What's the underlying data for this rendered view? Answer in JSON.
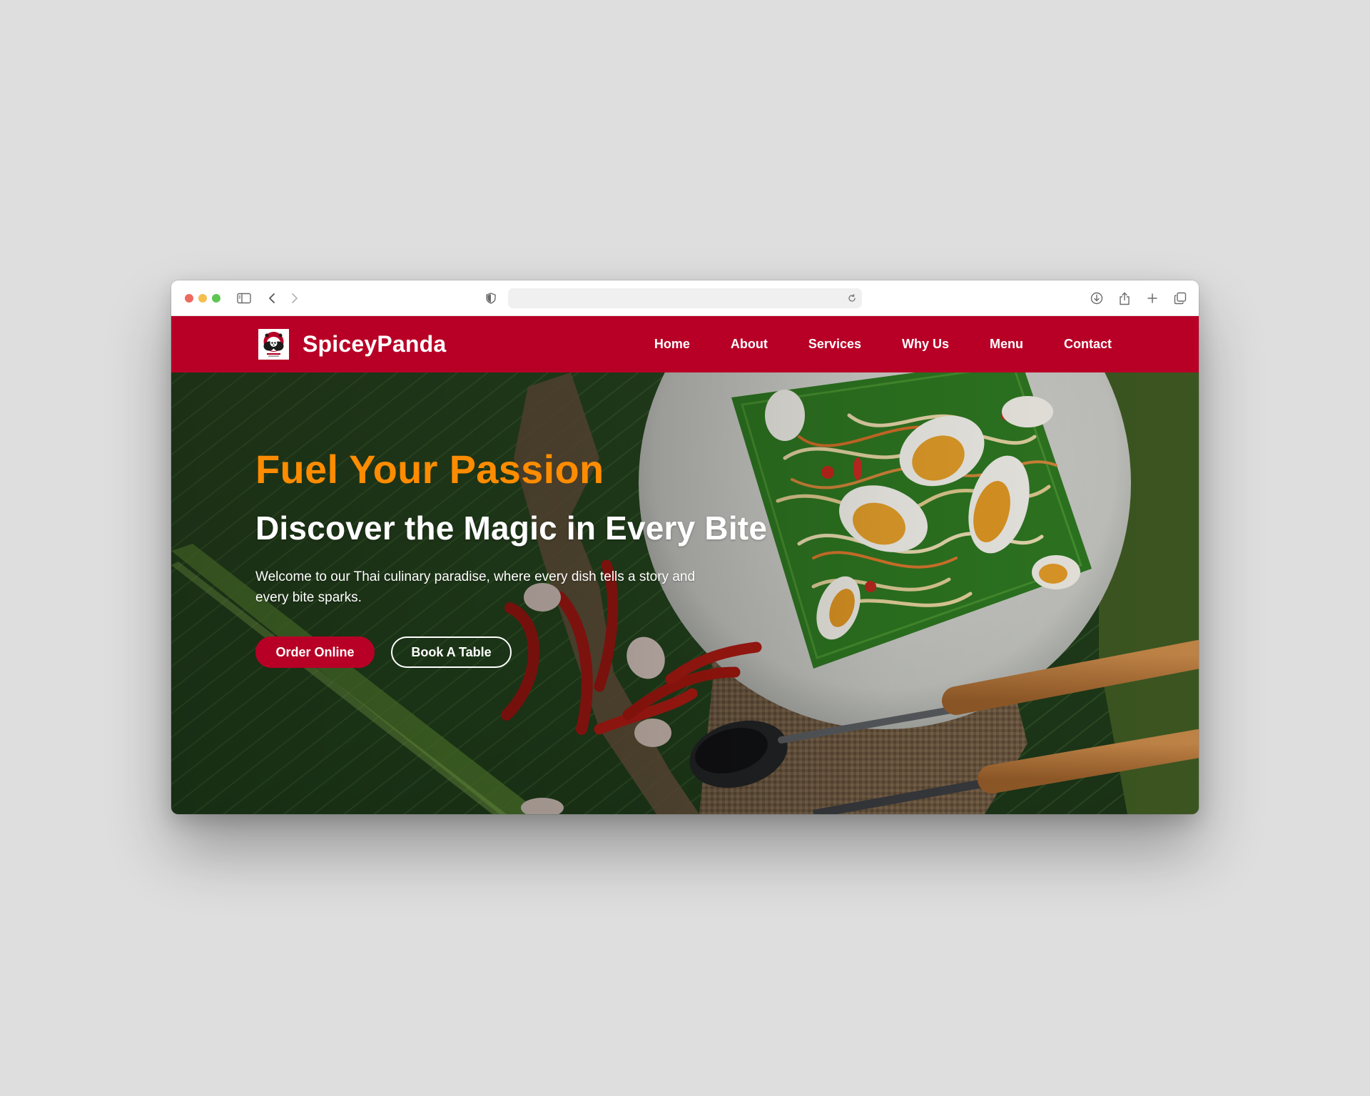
{
  "browser": {
    "address": "",
    "colors": {
      "close": "#ec6a5e",
      "minimize": "#f4bf4f",
      "zoom": "#61c554"
    }
  },
  "site": {
    "brand": "SpiceyPanda",
    "nav": [
      "Home",
      "About",
      "Services",
      "Why Us",
      "Menu",
      "Contact"
    ],
    "colors": {
      "header": "#b80026",
      "accent": "#ff8c00",
      "text": "#ffffff"
    }
  },
  "hero": {
    "tagline": "Fuel Your Passion",
    "title": "Discover the Magic in Every Bite",
    "description": "Welcome to our Thai culinary paradise, where every dish tells a story and every bite sparks.",
    "buttons": {
      "primary": "Order Online",
      "secondary": "Book A Table"
    }
  },
  "icons": {
    "sidebar": "sidebar-icon",
    "back": "chevron-left-icon",
    "forward": "chevron-right-icon",
    "privacy": "shield-icon",
    "reload": "reload-icon",
    "download": "download-icon",
    "share": "share-icon",
    "new_tab": "plus-icon",
    "tabs": "tabs-overview-icon"
  }
}
